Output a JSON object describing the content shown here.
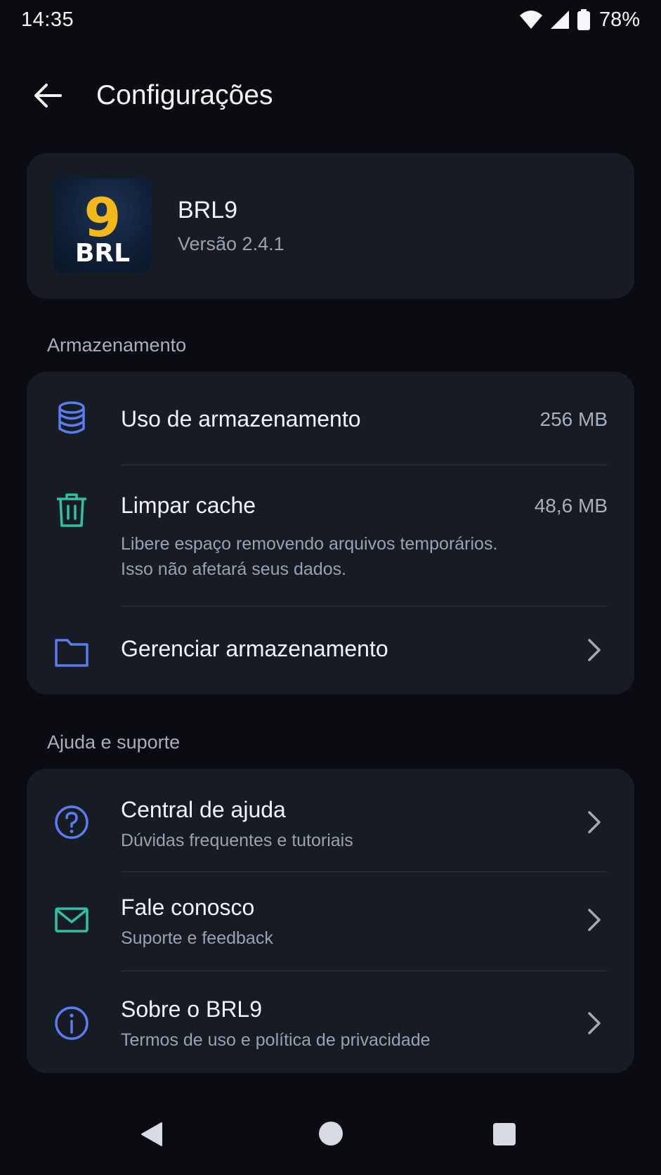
{
  "status": {
    "time": "14:35",
    "battery": "78%"
  },
  "header": {
    "title": "Configurações"
  },
  "app": {
    "logo_number": "9",
    "logo_text": "BRL",
    "name": "BRL9",
    "version": "Versão 2.4.1"
  },
  "storage": {
    "section_label": "Armazenamento",
    "items": [
      {
        "icon": "database-icon",
        "title": "Uso de armazenamento",
        "value": "256 MB"
      },
      {
        "icon": "trash-icon",
        "title": "Limpar cache",
        "value": "48,6 MB",
        "subtitle_line1": "Libere espaço removendo arquivos temporários.",
        "subtitle_line2": "Isso não afetará seus dados."
      },
      {
        "icon": "folder-icon",
        "title": "Gerenciar armazenamento"
      }
    ]
  },
  "support": {
    "section_label": "Ajuda e suporte",
    "items": [
      {
        "icon": "help-circle-icon",
        "title": "Central de ajuda",
        "subtitle": "Dúvidas frequentes e tutoriais"
      },
      {
        "icon": "mail-icon",
        "title": "Fale conosco",
        "subtitle": "Suporte e feedback"
      },
      {
        "icon": "info-icon",
        "title": "Sobre o BRL9",
        "subtitle": "Termos de uso e política de privacidade"
      }
    ]
  },
  "colors": {
    "background": "#0a0c11",
    "card": "#171b23",
    "accent_blue": "#5b7cf0",
    "accent_teal": "#2fc1a4",
    "logo_gold": "#f5b81c"
  }
}
